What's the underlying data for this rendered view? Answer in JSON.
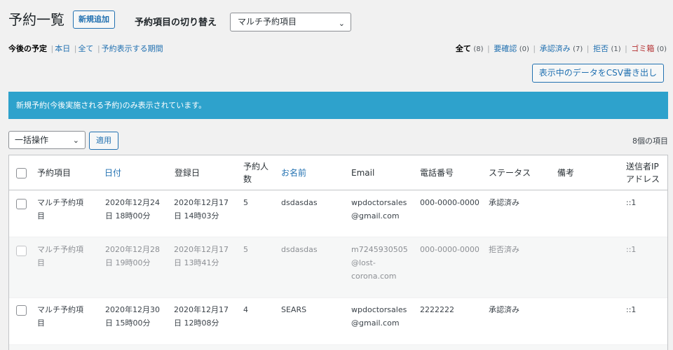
{
  "header": {
    "title": "予約一覧",
    "add_new": "新規追加",
    "switch_label": "予約項目の切り替え",
    "switch_value": "マルチ予約項目"
  },
  "filters_left": {
    "current": "今後の予定",
    "today": "本日",
    "all": "全て",
    "period": "予約表示する期間"
  },
  "filters_right": {
    "all": "全て",
    "all_count": "(8)",
    "pending": "要確認",
    "pending_count": "(0)",
    "approved": "承認済み",
    "approved_count": "(7)",
    "rejected": "拒否",
    "rejected_count": "(1)",
    "trash": "ゴミ箱",
    "trash_count": "(0)"
  },
  "csv_button": "表示中のデータをCSV書き出し",
  "notice": "新規予約(今後実施される予約)のみ表示されています。",
  "bulk": {
    "select": "一括操作",
    "apply": "適用"
  },
  "item_count": "8個の項目",
  "columns": {
    "item": "予約項目",
    "date": "日付",
    "registered": "登録日",
    "count_1": "予約人",
    "count_2": "数",
    "name": "お名前",
    "email": "Email",
    "phone": "電話番号",
    "status": "ステータス",
    "note": "備考",
    "ip_1": "送信者IP",
    "ip_2": "アドレス"
  },
  "rows": [
    {
      "item_1": "マルチ予約項",
      "item_2": "目",
      "date_1": "2020年12月24",
      "date_2": "日 18時00分",
      "reg_1": "2020年12月17",
      "reg_2": "日 14時03分",
      "count": "5",
      "name": "dsdasdas",
      "email_1": "wpdoctorsales",
      "email_2": "@gmail.com",
      "email_3": "",
      "phone": "000-0000-0000",
      "status": "承認済み",
      "ip": "::1"
    },
    {
      "item_1": "マルチ予約項",
      "item_2": "目",
      "date_1": "2020年12月28",
      "date_2": "日 19時00分",
      "reg_1": "2020年12月17",
      "reg_2": "日 13時41分",
      "count": "5",
      "name": "dsdasdas",
      "email_1": "m7245930505",
      "email_2": "@lost-",
      "email_3": "corona.com",
      "phone": "000-0000-0000",
      "status": "拒否済み",
      "ip": "::1"
    },
    {
      "item_1": "マルチ予約項",
      "item_2": "目",
      "date_1": "2020年12月30",
      "date_2": "日 15時00分",
      "reg_1": "2020年12月17",
      "reg_2": "日 12時08分",
      "count": "4",
      "name": "SEARS",
      "email_1": "wpdoctorsales",
      "email_2": "@gmail.com",
      "email_3": "",
      "phone": "2222222",
      "status": "承認済み",
      "ip": "::1"
    }
  ]
}
